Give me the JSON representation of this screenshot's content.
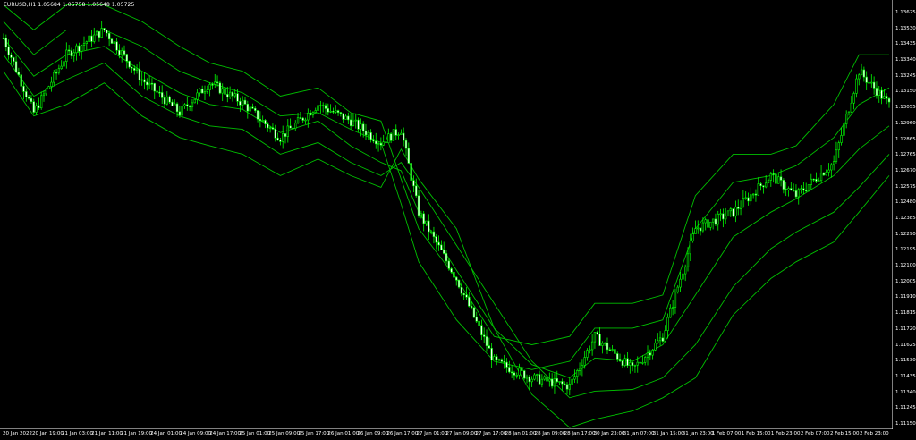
{
  "header": {
    "symbol": "EURUSD,H1",
    "ohlc": "1.05684 1.05758 1.05648 1.05725"
  },
  "colors": {
    "background": "#000000",
    "axis": "#ffffff",
    "bands": "#00c000",
    "bull_candle": "#000000",
    "bear_candle": "#ffffff",
    "wick": "#00ff00"
  },
  "price_scale": [
    "1.13625",
    "1.13530",
    "1.13435",
    "1.13340",
    "1.13245",
    "1.13150",
    "1.13055",
    "1.12960",
    "1.12865",
    "1.12765",
    "1.12670",
    "1.12575",
    "1.12480",
    "1.12385",
    "1.12290",
    "1.12195",
    "1.12100",
    "1.12005",
    "1.11910",
    "1.11815",
    "1.11720",
    "1.11625",
    "1.11530",
    "1.11435",
    "1.11340",
    "1.11245",
    "1.11150"
  ],
  "time_scale": [
    "20 Jan 2022",
    "20 Jan 19:00",
    "21 Jan 03:00",
    "21 Jan 11:00",
    "21 Jan 19:00",
    "24 Jan 01:00",
    "24 Jan 09:00",
    "24 Jan 17:00",
    "25 Jan 01:00",
    "25 Jan 09:00",
    "25 Jan 17:00",
    "26 Jan 01:00",
    "26 Jan 09:00",
    "26 Jan 17:00",
    "27 Jan 01:00",
    "27 Jan 09:00",
    "27 Jan 17:00",
    "28 Jan 01:00",
    "28 Jan 09:00",
    "28 Jan 17:00",
    "30 Jan 23:00",
    "31 Jan 07:00",
    "31 Jan 15:00",
    "31 Jan 23:00",
    "1 Feb 07:00",
    "1 Feb 15:00",
    "1 Feb 23:00",
    "2 Feb 07:00",
    "2 Feb 15:00",
    "2 Feb 23:00"
  ],
  "chart_data": {
    "type": "line",
    "symbol": "EURUSD",
    "timeframe": "H1",
    "ylim": [
      1.1109,
      1.1368
    ],
    "close_path": [
      {
        "t": 0,
        "price": 1.1345
      },
      {
        "t": 12,
        "price": 1.13
      },
      {
        "t": 25,
        "price": 1.1335
      },
      {
        "t": 40,
        "price": 1.135
      },
      {
        "t": 55,
        "price": 1.132
      },
      {
        "t": 70,
        "price": 1.13
      },
      {
        "t": 82,
        "price": 1.1318
      },
      {
        "t": 95,
        "price": 1.1306
      },
      {
        "t": 110,
        "price": 1.1285
      },
      {
        "t": 125,
        "price": 1.1305
      },
      {
        "t": 138,
        "price": 1.1295
      },
      {
        "t": 150,
        "price": 1.1282
      },
      {
        "t": 158,
        "price": 1.129
      },
      {
        "t": 165,
        "price": 1.124
      },
      {
        "t": 180,
        "price": 1.12
      },
      {
        "t": 195,
        "price": 1.115
      },
      {
        "t": 210,
        "price": 1.114
      },
      {
        "t": 225,
        "price": 1.1135
      },
      {
        "t": 235,
        "price": 1.1165
      },
      {
        "t": 250,
        "price": 1.1145
      },
      {
        "t": 262,
        "price": 1.1165
      },
      {
        "t": 275,
        "price": 1.123
      },
      {
        "t": 290,
        "price": 1.124
      },
      {
        "t": 305,
        "price": 1.1262
      },
      {
        "t": 315,
        "price": 1.125
      },
      {
        "t": 330,
        "price": 1.127
      },
      {
        "t": 340,
        "price": 1.1325
      },
      {
        "t": 352,
        "price": 1.1305
      }
    ],
    "bands": {
      "upper_outer": [
        1.1365,
        1.135,
        1.1365,
        1.1365,
        1.1355,
        1.134,
        1.133,
        1.1325,
        1.131,
        1.1315,
        1.13,
        1.1295,
        1.126,
        1.123,
        1.12,
        1.1165,
        1.116,
        1.1165,
        1.1185,
        1.1185,
        1.119,
        1.125,
        1.1275,
        1.1275,
        1.128,
        1.1305,
        1.1335,
        1.1335
      ],
      "upper_inner": [
        1.1355,
        1.1335,
        1.135,
        1.135,
        1.134,
        1.1325,
        1.1318,
        1.1312,
        1.1298,
        1.13,
        1.129,
        1.1282,
        1.1245,
        1.121,
        1.1175,
        1.115,
        1.1145,
        1.115,
        1.117,
        1.117,
        1.1175,
        1.123,
        1.1258,
        1.1262,
        1.1268,
        1.1285,
        1.1305,
        1.1315
      ],
      "middle": [
        1.1345,
        1.1322,
        1.1335,
        1.134,
        1.1325,
        1.1312,
        1.1305,
        1.1302,
        1.1288,
        1.1295,
        1.128,
        1.127,
        1.1265,
        1.124,
        1.1205,
        1.117,
        1.1148,
        1.114,
        1.1152,
        1.115,
        1.116,
        1.119,
        1.1225,
        1.124,
        1.1248,
        1.1262,
        1.1278,
        1.1292
      ],
      "lower_inner": [
        1.1335,
        1.131,
        1.132,
        1.133,
        1.131,
        1.1298,
        1.1292,
        1.129,
        1.1275,
        1.1282,
        1.127,
        1.1262,
        1.127,
        1.1255,
        1.122,
        1.1185,
        1.115,
        1.1128,
        1.1132,
        1.1133,
        1.114,
        1.116,
        1.1195,
        1.1218,
        1.1228,
        1.124,
        1.1255,
        1.1275
      ],
      "lower_outer": [
        1.1325,
        1.1298,
        1.1305,
        1.1318,
        1.1298,
        1.1285,
        1.128,
        1.1275,
        1.1262,
        1.1272,
        1.1262,
        1.1255,
        1.1278,
        1.126,
        1.123,
        1.117,
        1.113,
        1.111,
        1.1115,
        1.112,
        1.1128,
        1.114,
        1.1178,
        1.12,
        1.121,
        1.1222,
        1.124,
        1.1262
      ]
    }
  }
}
